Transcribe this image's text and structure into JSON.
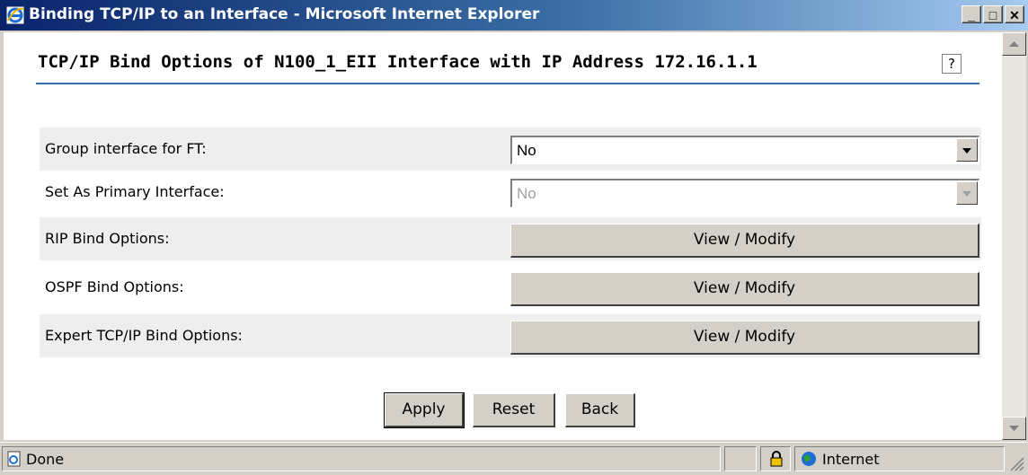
{
  "window": {
    "title": "Binding TCP/IP to an Interface - Microsoft Internet Explorer",
    "minimize": "_",
    "maximize": "□",
    "close": "✕"
  },
  "page": {
    "heading": "TCP/IP Bind Options of N100_1_EII Interface with IP Address 172.16.1.1",
    "help_icon": "?"
  },
  "form": {
    "rows": [
      {
        "label": "Group interface for FT:",
        "value": "No"
      },
      {
        "label": "Set As Primary Interface:",
        "value": "No"
      },
      {
        "label": "RIP Bind Options:",
        "button": "View / Modify"
      },
      {
        "label": "OSPF Bind Options:",
        "button": "View / Modify"
      },
      {
        "label": "Expert TCP/IP Bind Options:",
        "button": "View / Modify"
      }
    ]
  },
  "actions": {
    "apply": "Apply",
    "reset": "Reset",
    "back": "Back"
  },
  "status": {
    "text": "Done",
    "zone": "Internet"
  },
  "icons": [
    "ie-logo-icon",
    "help-icon",
    "dropdown-arrow-icon",
    "page-icon",
    "lock-icon",
    "globe-icon"
  ],
  "colors": {
    "titlebar_start": "#0a246a",
    "titlebar_end": "#a6caf0",
    "heading_rule": "#3a6ea5",
    "row_shade": "#eeeeee"
  }
}
